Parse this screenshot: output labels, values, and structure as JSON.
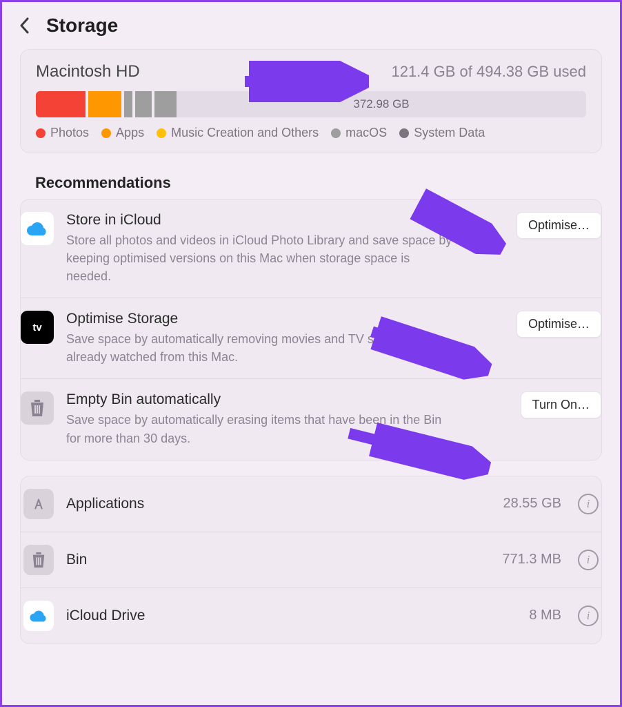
{
  "header": {
    "title": "Storage"
  },
  "disk": {
    "name": "Macintosh HD",
    "usage_text": "121.4 GB of 494.38 GB used",
    "free_text": "372.98 GB",
    "segments": [
      {
        "key": "photos",
        "color": "#f44336",
        "pct": 9
      },
      {
        "key": "apps",
        "color": "#ff9800",
        "pct": 6
      },
      {
        "key": "music",
        "color": "#9e9e9e",
        "pct": 1.5
      },
      {
        "key": "macos",
        "color": "#9e9e9e",
        "pct": 3
      },
      {
        "key": "system",
        "color": "#9e9e9e",
        "pct": 4
      }
    ],
    "legend": [
      {
        "label": "Photos",
        "color": "#f44336"
      },
      {
        "label": "Apps",
        "color": "#ff9800"
      },
      {
        "label": "Music Creation and Others",
        "color": "#ffc107"
      },
      {
        "label": "macOS",
        "color": "#9e9e9e"
      },
      {
        "label": "System Data",
        "color": "#7c7580"
      }
    ]
  },
  "recommendations": {
    "heading": "Recommendations",
    "items": [
      {
        "icon": "cloud",
        "title": "Store in iCloud",
        "desc": "Store all photos and videos in iCloud Photo Library and save space by keeping optimised versions on this Mac when storage space is needed.",
        "button": "Optimise…"
      },
      {
        "icon": "tv",
        "title": "Optimise Storage",
        "desc": "Save space by automatically removing movies and TV shows you've already watched from this Mac.",
        "button": "Optimise…"
      },
      {
        "icon": "trash",
        "title": "Empty Bin automatically",
        "desc": "Save space by automatically erasing items that have been in the Bin for more than 30 days.",
        "button": "Turn On…"
      }
    ]
  },
  "categories": [
    {
      "icon": "apps",
      "name": "Applications",
      "size": "28.55 GB"
    },
    {
      "icon": "trash",
      "name": "Bin",
      "size": "771.3 MB"
    },
    {
      "icon": "cloud",
      "name": "iCloud Drive",
      "size": "8 MB"
    }
  ]
}
